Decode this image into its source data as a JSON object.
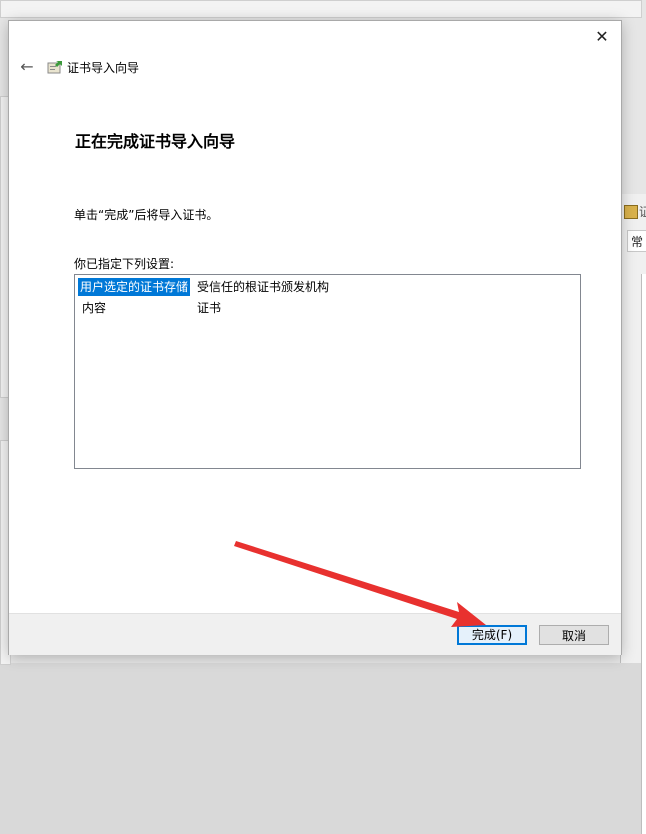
{
  "background": {
    "right_tab_label": "常",
    "right_title_fragment": "证"
  },
  "dialog": {
    "close_label": "✕",
    "back_label": "←",
    "wizard_title": "证书导入向导",
    "heading": "正在完成证书导入向导",
    "instruction": "单击“完成”后将导入证书。",
    "settings_label": "你已指定下列设置:",
    "settings": [
      {
        "key": "用户选定的证书存储",
        "value": "受信任的根证书颁发机构",
        "selected": true
      },
      {
        "key": "内容",
        "value": "证书",
        "selected": false
      }
    ],
    "finish_label": "完成(F)",
    "cancel_label": "取消"
  },
  "colors": {
    "selection": "#0078d7",
    "annotation_arrow": "#e8312f"
  },
  "icons": {
    "wizard_icon": "certificate-wizard-icon",
    "back_icon": "arrow-left-icon",
    "close_icon": "close-icon"
  }
}
